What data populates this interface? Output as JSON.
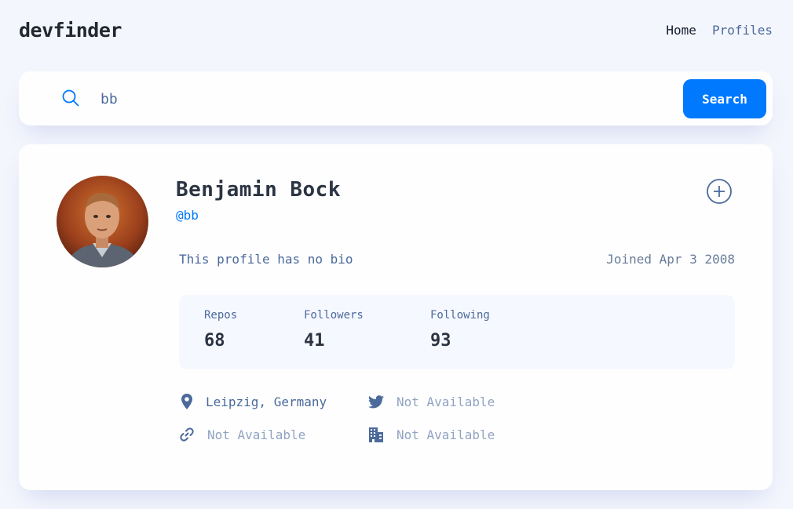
{
  "app": {
    "logo": "devfinder"
  },
  "nav": {
    "home": "Home",
    "profiles": "Profiles"
  },
  "search": {
    "value": "bb",
    "placeholder": "",
    "button_label": "Search"
  },
  "profile": {
    "name": "Benjamin Bock",
    "login": "@bb",
    "bio": "This profile has no bio",
    "joined": "Joined Apr 3 2008",
    "stats": {
      "repos_label": "Repos",
      "repos": "68",
      "followers_label": "Followers",
      "followers": "41",
      "following_label": "Following",
      "following": "93"
    },
    "links": {
      "location": "Leipzig, Germany",
      "twitter": "Not Available",
      "website": "Not Available",
      "company": "Not Available"
    }
  },
  "colors": {
    "accent": "#0079ff",
    "background": "#f4f6fd",
    "card": "#fefefe",
    "text_dark": "#2b3442",
    "text_muted": "#4b6a9b"
  },
  "icons": [
    "search-icon",
    "add-circle-icon",
    "location-pin-icon",
    "twitter-icon",
    "link-icon",
    "company-building-icon"
  ]
}
